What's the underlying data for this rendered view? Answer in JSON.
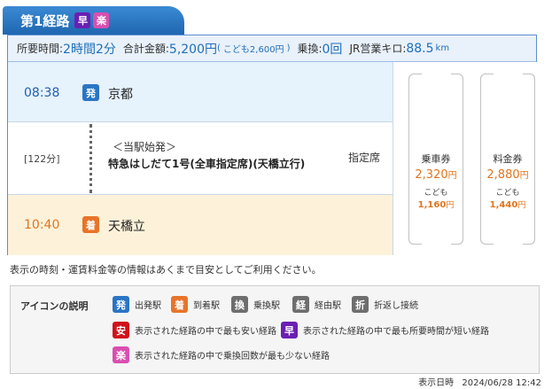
{
  "route": {
    "tab_title": "第1経路",
    "tab_badges": [
      {
        "icon": "haya-badge",
        "label": "早",
        "color": "#6a1fb3"
      },
      {
        "icon": "raku-badge",
        "label": "楽",
        "color": "#d94fb0"
      }
    ]
  },
  "summary": {
    "time_label": "所要時間:",
    "time_value": "2時間2分",
    "fare_label": "合計金額:",
    "fare_value": "5,200円",
    "child_fare_prefix": "(",
    "child_fare_label": "こども",
    "child_fare_value": "2,600円",
    "child_fare_suffix": ")",
    "transfer_label": "乗換:",
    "transfer_value": "0回",
    "km_label": "JR営業キロ:",
    "km_value": "88.5",
    "km_unit": "km"
  },
  "departure": {
    "time": "08:38",
    "badge": "発",
    "station": "京都"
  },
  "segment": {
    "duration": "[122分]",
    "origin_note": "＜当駅始発＞",
    "train": "特急はしだて1号(全車指定席)(天橋立行)",
    "seat": "指定席"
  },
  "arrival": {
    "time": "10:40",
    "badge": "着",
    "station": "天橋立"
  },
  "fares": [
    {
      "title": "乗車券",
      "amount": "2,320",
      "unit": "円",
      "child_label": "こども",
      "child_amount": "1,160",
      "child_unit": "円"
    },
    {
      "title": "料金券",
      "amount": "2,880",
      "unit": "円",
      "child_label": "こども",
      "child_amount": "1,440",
      "child_unit": "円"
    }
  ],
  "note": "表示の時刻・運賃料金等の情報はあくまで目安としてご利用ください。",
  "legend": {
    "title": "アイコンの説明",
    "items": [
      {
        "icon": "hatsu-icon",
        "badge": "発",
        "label": "出発駅"
      },
      {
        "icon": "chaku-icon",
        "badge": "着",
        "label": "到着駅"
      },
      {
        "icon": "kan-icon",
        "badge": "換",
        "label": "乗換駅"
      },
      {
        "icon": "kei-icon",
        "badge": "経",
        "label": "経由駅"
      },
      {
        "icon": "ori-icon",
        "badge": "折",
        "label": "折返し接続"
      },
      {
        "icon": "yasu-icon",
        "badge": "安",
        "label": "表示された経路の中で最も安い経路"
      },
      {
        "icon": "haya-icon",
        "badge": "早",
        "label": "表示された経路の中で最も所要時間が短い経路"
      },
      {
        "icon": "raku-icon",
        "badge": "楽",
        "label": "表示された経路の中で乗換回数が最も少ない経路"
      }
    ]
  },
  "footer": {
    "label": "表示日時",
    "datetime": "2024/06/28 12:42"
  },
  "colors": {
    "accent_blue": "#2b75c4",
    "arrival_orange": "#e8742a",
    "fare_orange": "#e0751f",
    "haya_purple": "#6a1fb3",
    "raku_pink": "#d94fb0",
    "yasu_red": "#d0121b"
  }
}
